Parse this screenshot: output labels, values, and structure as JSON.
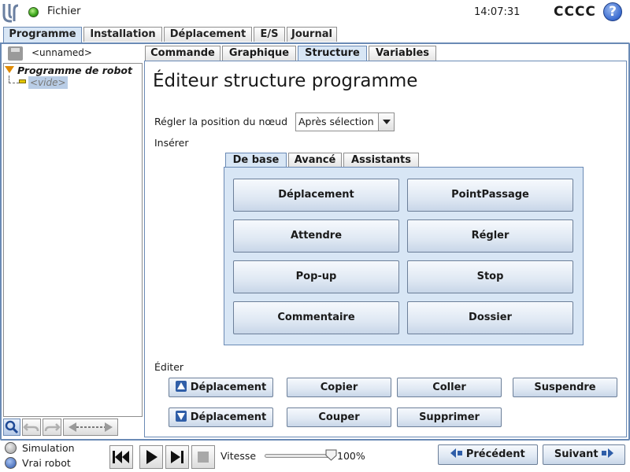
{
  "topbar": {
    "logo_icon": "ur-logo-icon",
    "status_icon": "robot-status-green-icon",
    "file_menu": "Fichier",
    "clock": "14:07:31",
    "robot_name": "CCCC",
    "help_label": "?"
  },
  "main_tabs": [
    "Programme",
    "Installation",
    "Déplacement",
    "E/S",
    "Journal"
  ],
  "active_main_tab": "Programme",
  "program": {
    "file_name": "<unnamed>",
    "tree_root": "Programme de robot",
    "tree_empty": "<vide>"
  },
  "sub_tabs": [
    "Commande",
    "Graphique",
    "Structure",
    "Variables"
  ],
  "active_sub_tab": "Structure",
  "editor": {
    "title": "Éditeur structure programme",
    "node_position_label": "Régler la position du nœud",
    "node_position_value": "Après sélection",
    "insert_label": "Insérer",
    "insert_tabs": [
      "De base",
      "Avancé",
      "Assistants"
    ],
    "active_insert_tab": "De base",
    "basic_buttons": [
      "Déplacement",
      "PointPassage",
      "Attendre",
      "Régler",
      "Pop-up",
      "Stop",
      "Commentaire",
      "Dossier"
    ],
    "edit_label": "Éditer",
    "edit_buttons": {
      "move_up": "Déplacement",
      "move_down": "Déplacement",
      "copy": "Copier",
      "paste": "Coller",
      "suspend": "Suspendre",
      "cut": "Couper",
      "delete": "Supprimer"
    }
  },
  "footer": {
    "simulation_label": "Simulation",
    "real_robot_label": "Vrai robot",
    "selected_mode": "Vrai robot",
    "speed_label": "Vitesse",
    "speed_value": "100%",
    "speed_fraction": 1.0,
    "prev_label": "Précédent",
    "next_label": "Suivant"
  },
  "colors": {
    "accent_blue": "#6a8ab5",
    "active_tab": "#d8e6f5",
    "tree_marker": "#e08a00"
  }
}
